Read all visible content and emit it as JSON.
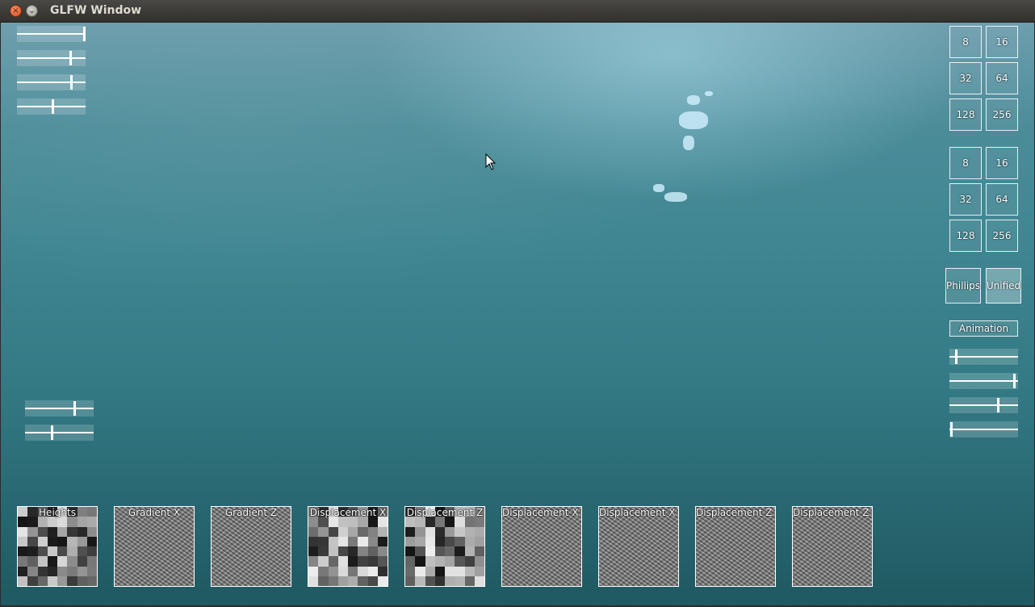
{
  "window": {
    "title": "GLFW Window",
    "close_glyph": "×",
    "minimize_glyph": "⌄"
  },
  "left_sliders": [
    {
      "name": "param-slider-1",
      "value": 1.0
    },
    {
      "name": "param-slider-2",
      "value": 0.78
    },
    {
      "name": "param-slider-3",
      "value": 0.79
    },
    {
      "name": "param-slider-4",
      "value": 0.52
    }
  ],
  "bottom_left_sliders": [
    {
      "name": "param-slider-5",
      "value": 0.72
    },
    {
      "name": "param-slider-6",
      "value": 0.39
    }
  ],
  "resolution_group_1": [
    "8",
    "16",
    "32",
    "64",
    "128",
    "256"
  ],
  "resolution_group_2": [
    "8",
    "16",
    "32",
    "64",
    "128",
    "256"
  ],
  "spectrum": {
    "phillips": "Phillips",
    "unified": "Unified"
  },
  "animation_label": "Animation",
  "right_sliders": [
    {
      "name": "anim-slider-1",
      "value": 0.09
    },
    {
      "name": "anim-slider-2",
      "value": 0.94
    },
    {
      "name": "anim-slider-3",
      "value": 0.71
    },
    {
      "name": "anim-slider-4",
      "value": 0.02
    }
  ],
  "textures": [
    {
      "label": "Heights",
      "style": "blocky"
    },
    {
      "label": "Gradient X",
      "style": "noise"
    },
    {
      "label": "Gradient Z",
      "style": "noise"
    },
    {
      "label": "Displacement X",
      "style": "blocky"
    },
    {
      "label": "Displacement Z",
      "style": "blocky"
    },
    {
      "label": "Displacement X dX",
      "style": "noise"
    },
    {
      "label": "Displacement X dZ",
      "style": "noise"
    },
    {
      "label": "Displacement Z dX",
      "style": "noise"
    },
    {
      "label": "Displacement Z dZ",
      "style": "noise"
    }
  ],
  "colors": {
    "ocean_top": "#6e9eae",
    "ocean_bottom": "#1f5962",
    "ui_white": "#ffffff",
    "close_button": "#df4a16"
  }
}
